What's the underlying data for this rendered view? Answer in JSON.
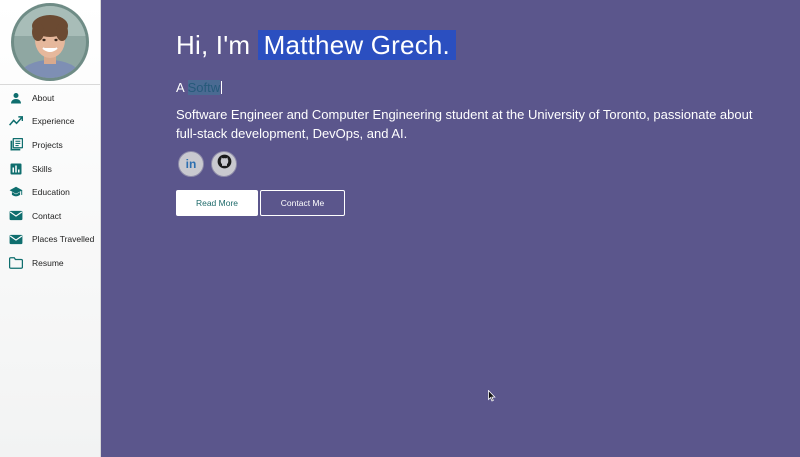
{
  "sidebar": {
    "items": [
      {
        "label": "About",
        "icon": "person-icon"
      },
      {
        "label": "Experience",
        "icon": "trending-up-icon"
      },
      {
        "label": "Projects",
        "icon": "library-books-icon"
      },
      {
        "label": "Skills",
        "icon": "bar-chart-icon"
      },
      {
        "label": "Education",
        "icon": "graduation-cap-icon"
      },
      {
        "label": "Contact",
        "icon": "mail-icon"
      },
      {
        "label": "Places Travelled",
        "icon": "mail-icon"
      },
      {
        "label": "Resume",
        "icon": "folder-icon"
      }
    ]
  },
  "hero": {
    "greeting_prefix": "Hi, I'm ",
    "name": "Matthew Grech.",
    "typed_prefix": "A ",
    "typed_text": "Softw",
    "description": "Software Engineer and Computer Engineering student at the University of Toronto, passionate about full-stack development, DevOps, and AI."
  },
  "socials": [
    {
      "name": "LinkedIn",
      "icon": "linkedin-icon",
      "glyph": "in"
    },
    {
      "name": "GitHub",
      "icon": "github-icon"
    }
  ],
  "buttons": {
    "read_more": "Read More",
    "contact_me": "Contact Me"
  },
  "colors": {
    "background": "#5b568c",
    "accent": "#0f6e6e",
    "name_highlight": "#2b4fc0",
    "sidebar": "#ffffff"
  }
}
